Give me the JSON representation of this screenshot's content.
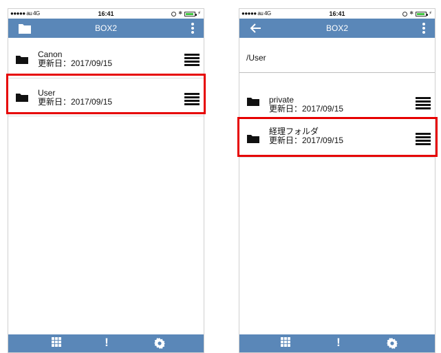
{
  "left_screen": {
    "status": {
      "signal": "●●●●● au  4G",
      "time": "16:41"
    },
    "nav": {
      "title": "BOX2",
      "left_icon": "folder-icon",
      "right_icon": "more-vertical-icon"
    },
    "items": [
      {
        "name": "Canon",
        "date": "更新日：2017/09/15"
      },
      {
        "name": "User",
        "date": "更新日：2017/09/15"
      }
    ],
    "highlighted_item": "User"
  },
  "right_screen": {
    "status": {
      "signal": "●●●●● au  4G",
      "time": "16:41"
    },
    "nav": {
      "title": "BOX2",
      "left_icon": "back-arrow-icon",
      "right_icon": "more-vertical-icon"
    },
    "path": "/User",
    "items": [
      {
        "name": "private",
        "date": "更新日：2017/09/15"
      },
      {
        "name": "経理フォルダ",
        "date": "更新日：2017/09/15"
      }
    ],
    "highlighted_item": "経理フォルダ"
  },
  "tabbar": {
    "icons": [
      "grid-icon",
      "exclamation-icon",
      "gear-icon"
    ]
  },
  "colors": {
    "nav_bg": "#5a87b8",
    "highlight": "#e60000",
    "battery": "#3ec43e"
  }
}
